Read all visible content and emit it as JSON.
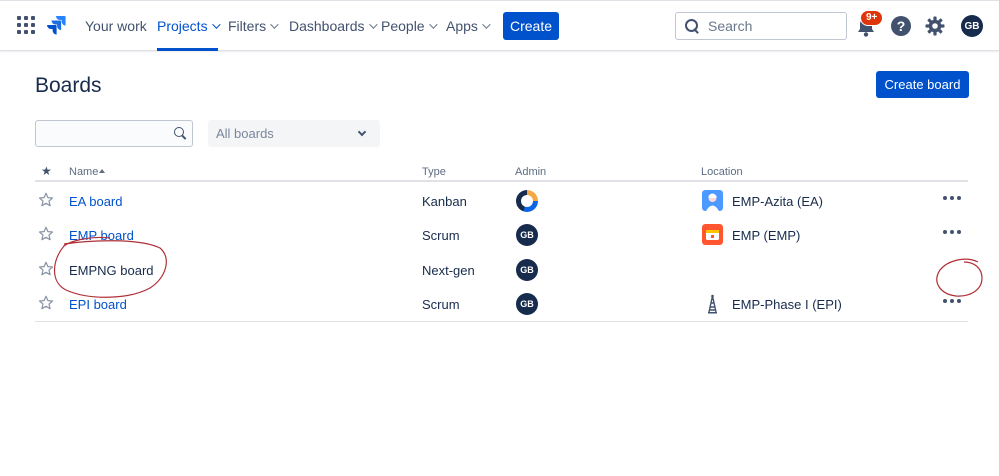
{
  "nav": {
    "items": [
      {
        "label": "Your work",
        "dropdown": false,
        "active": false
      },
      {
        "label": "Projects",
        "dropdown": true,
        "active": true
      },
      {
        "label": "Filters",
        "dropdown": true,
        "active": false
      },
      {
        "label": "Dashboards",
        "dropdown": true,
        "active": false
      },
      {
        "label": "People",
        "dropdown": true,
        "active": false
      },
      {
        "label": "Apps",
        "dropdown": true,
        "active": false
      }
    ],
    "create_label": "Create",
    "search_placeholder": "Search",
    "notification_badge": "9+",
    "help_glyph": "?",
    "avatar_initials": "GB"
  },
  "page": {
    "title": "Boards",
    "create_board_label": "Create board",
    "filter_value": "",
    "select_value": "All boards"
  },
  "table": {
    "headers": {
      "star": "★",
      "name": "Name",
      "type": "Type",
      "admin": "Admin",
      "location": "Location"
    },
    "rows": [
      {
        "name": "EA board",
        "type": "Kanban",
        "admin": "",
        "admin_kind": "ring",
        "location": "EMP-Azita (EA)",
        "location_icon": "avatar-blue-icon",
        "has_menu": true
      },
      {
        "name": "EMP board",
        "type": "Scrum",
        "admin": "GB",
        "admin_kind": "initials",
        "location": "EMP (EMP)",
        "location_icon": "orange-project-icon",
        "has_menu": true
      },
      {
        "name": "EMPNG board",
        "type": "Next-gen",
        "admin": "GB",
        "admin_kind": "initials",
        "location": "",
        "location_icon": "",
        "has_menu": false
      },
      {
        "name": "EPI board",
        "type": "Scrum",
        "admin": "GB",
        "admin_kind": "initials",
        "location": "EMP-Phase I (EPI)",
        "location_icon": "tower-icon",
        "has_menu": true
      }
    ]
  },
  "colors": {
    "brand_blue": "#0052cc",
    "text": "#172b4d",
    "annotation_red": "#b03038",
    "badge_red": "#de350b"
  }
}
